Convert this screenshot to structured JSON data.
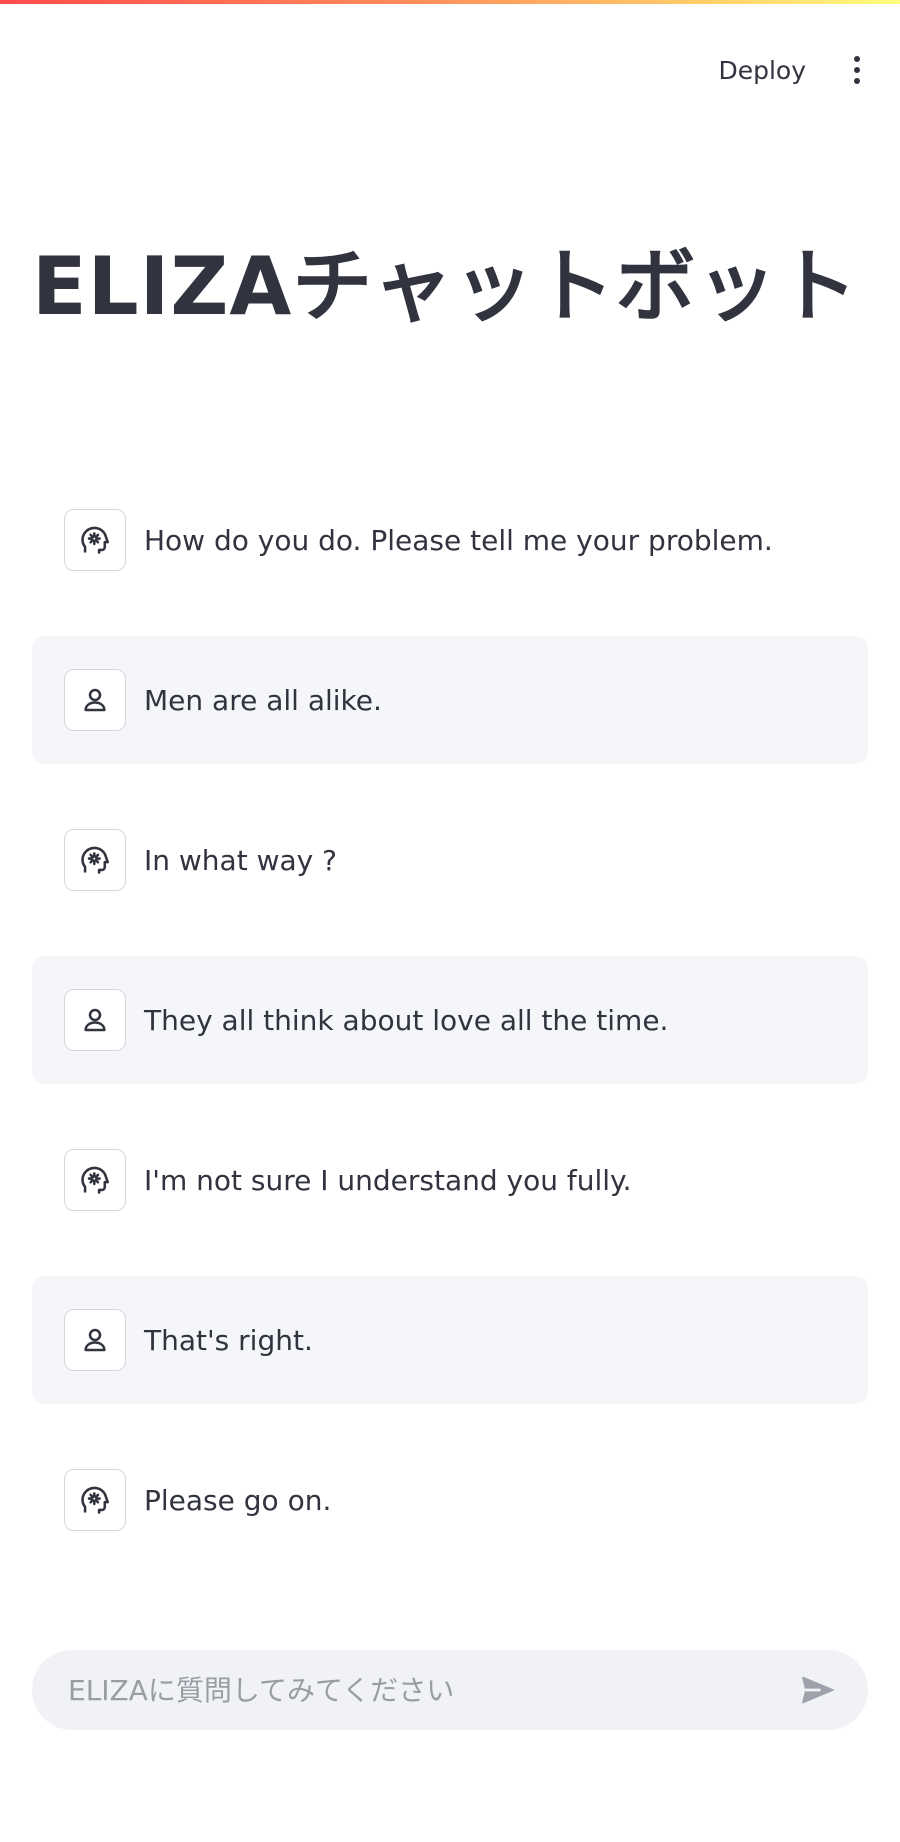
{
  "header": {
    "deploy_label": "Deploy",
    "menu_icon": "more-vertical-icon",
    "gradient_colors": [
      "#ff4b4b",
      "#ff8c5a",
      "#ffd26b",
      "#fffd80"
    ]
  },
  "page": {
    "title": "ELIZAチャットボット"
  },
  "chat": {
    "messages": [
      {
        "role": "assistant",
        "icon": "bot-head-gear-icon",
        "text": "How do you do. Please tell me your problem."
      },
      {
        "role": "user",
        "icon": "user-icon",
        "text": "Men are all alike."
      },
      {
        "role": "assistant",
        "icon": "bot-head-gear-icon",
        "text": "In what way ?"
      },
      {
        "role": "user",
        "icon": "user-icon",
        "text": "They all think about love all the time."
      },
      {
        "role": "assistant",
        "icon": "bot-head-gear-icon",
        "text": "I'm not sure I understand you fully."
      },
      {
        "role": "user",
        "icon": "user-icon",
        "text": "That's right."
      },
      {
        "role": "assistant",
        "icon": "bot-head-gear-icon",
        "text": "Please go on."
      }
    ]
  },
  "input": {
    "placeholder": "ELIZAに質問してみてください",
    "value": "",
    "send_icon": "send-icon"
  },
  "colors": {
    "text": "#31333f",
    "user_bubble": "#f5f6f9",
    "input_bg": "#f0f2f6",
    "placeholder": "#9a9ca4",
    "avatar_border": "#d5d7dd"
  }
}
